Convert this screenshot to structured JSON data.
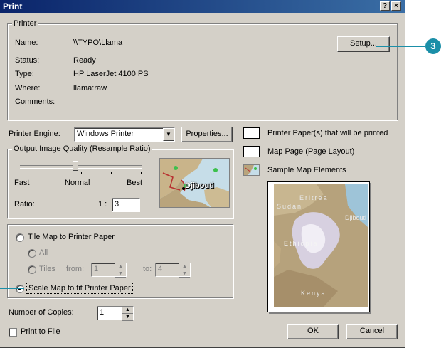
{
  "window": {
    "title": "Print"
  },
  "printer_group": {
    "legend": "Printer",
    "name_label": "Name:",
    "name_value": "\\\\TYPO\\Llama",
    "status_label": "Status:",
    "status_value": "Ready",
    "type_label": "Type:",
    "type_value": "HP LaserJet 4100 PS",
    "where_label": "Where:",
    "where_value": "llama:raw",
    "comments_label": "Comments:",
    "setup_button": "Setup..."
  },
  "engine": {
    "label": "Printer Engine:",
    "value": "Windows Printer",
    "properties_button": "Properties..."
  },
  "quality_group": {
    "legend": "Output Image Quality (Resample Ratio)",
    "fast": "Fast",
    "normal": "Normal",
    "best": "Best",
    "ratio_label": "Ratio:",
    "ratio_prefix": "1 :",
    "ratio_value": "3",
    "slider_level": 0.45
  },
  "thumb_map": {
    "label": "Djibouti"
  },
  "legend_items": [
    {
      "label": "Printer Paper(s) that will be printed"
    },
    {
      "label": "Map Page (Page Layout)"
    },
    {
      "label": "Sample Map Elements"
    }
  ],
  "preview_map": {
    "labels": [
      "Eritrea",
      "Sudan",
      "Djibouti",
      "Ethiopia",
      "Kenya"
    ]
  },
  "tiling": {
    "tile_option": "Tile Map to Printer Paper",
    "all_option": "All",
    "tiles_option": "Tiles",
    "from_label": "from:",
    "from_value": "1",
    "to_label": "to:",
    "to_value": "4",
    "scale_option": "Scale Map to fit Printer Paper"
  },
  "copies": {
    "label": "Number of Copies:",
    "value": "1"
  },
  "print_to_file": {
    "label": "Print to File"
  },
  "buttons": {
    "ok": "OK",
    "cancel": "Cancel",
    "help": "?",
    "close": "×"
  },
  "callout": {
    "number": "3"
  },
  "colors": {
    "title_start": "#0a246a",
    "title_end": "#3a6ea5",
    "dialog_bg": "#d4d0c8",
    "callout": "#1b8fa8"
  }
}
